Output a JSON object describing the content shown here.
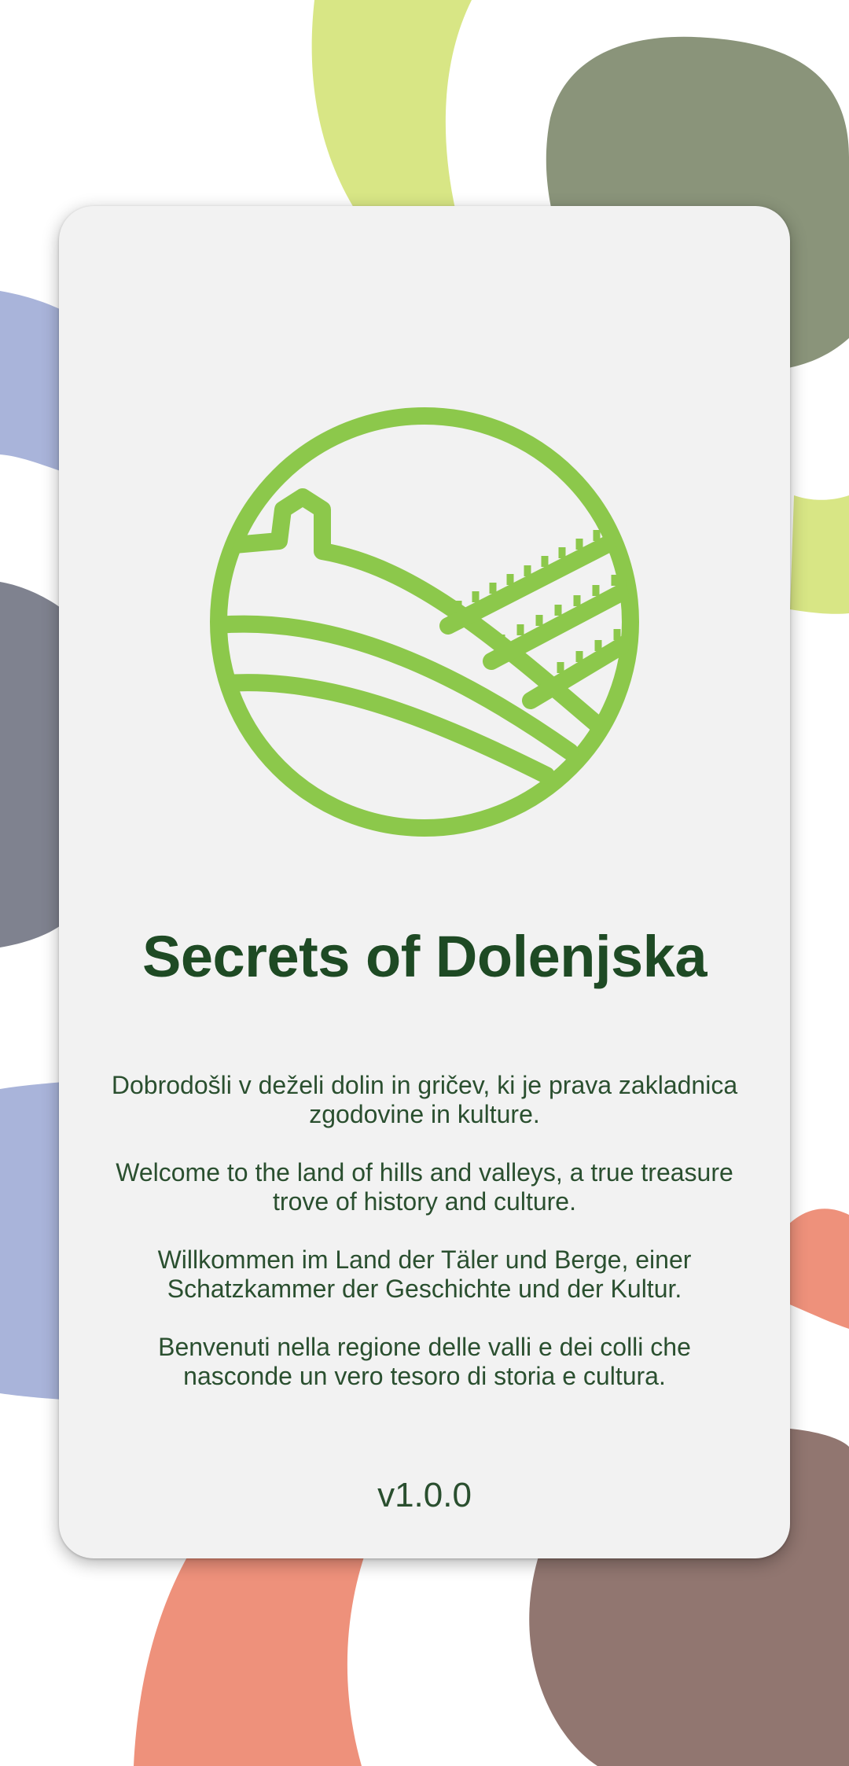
{
  "app": {
    "title": "Secrets of Dolenjska",
    "version": "v1.0.0"
  },
  "welcome": {
    "sl": "Dobrodošli v deželi dolin in gričev, ki je prava zakladnica zgodovine in kulture.",
    "en": "Welcome to the land of hills and valleys, a true treasure trove of history and culture.",
    "de": "Willkommen im Land der Täler und Berge, einer Schatzkammer der Geschichte und der Kultur.",
    "it": "Benvenuti nella regione delle valli e dei colli che nasconde un vero tesoro di storia e cultura."
  },
  "icons": {
    "logo": "hills-vineyard-church-logo-icon"
  },
  "colors": {
    "logo_green": "#8cc84b",
    "title_green": "#1e4a24",
    "text_green": "#2a4f2f",
    "card": "#f2f2f2",
    "blob_lime": "#d8e685",
    "blob_olive": "#8a947a",
    "blob_periwinkle": "#a9b4da",
    "blob_slate": "#7f828f",
    "blob_salmon": "#ee917b",
    "blob_mauve": "#917670"
  }
}
